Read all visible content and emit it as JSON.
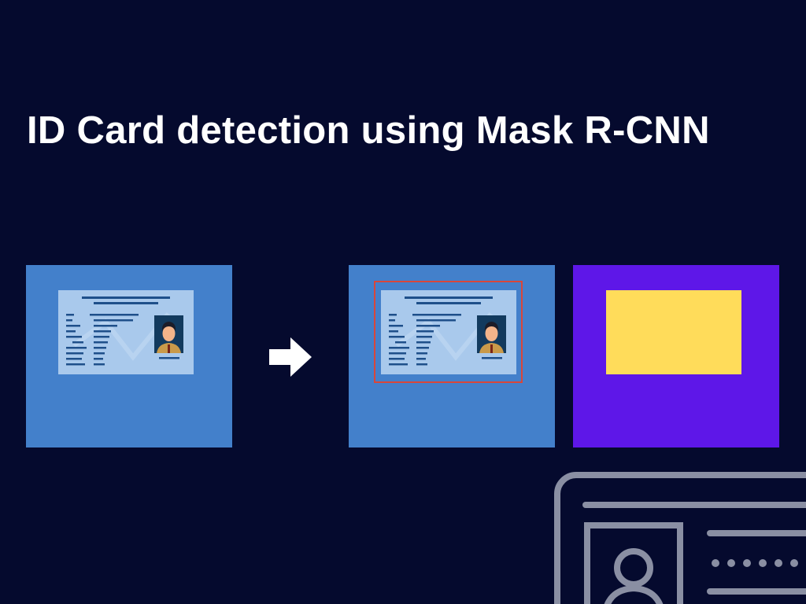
{
  "title": "ID Card detection using Mask R-CNN",
  "colors": {
    "background": "#050a2e",
    "photo_panel": "#4380cb",
    "mask_panel": "#5e17e8",
    "id_card": "#a9c9ec",
    "bounding_box": "#d9463a",
    "mask": "#ffdc5a",
    "decoration_stroke": "#8a8fa3"
  },
  "panels": [
    {
      "role": "input-image",
      "content": "id-card"
    },
    {
      "role": "detection-result",
      "content": "id-card-with-bounding-box"
    },
    {
      "role": "segmentation-mask",
      "content": "mask"
    }
  ],
  "icons": [
    "right-arrow-icon",
    "id-card-outline-icon",
    "user-icon"
  ]
}
